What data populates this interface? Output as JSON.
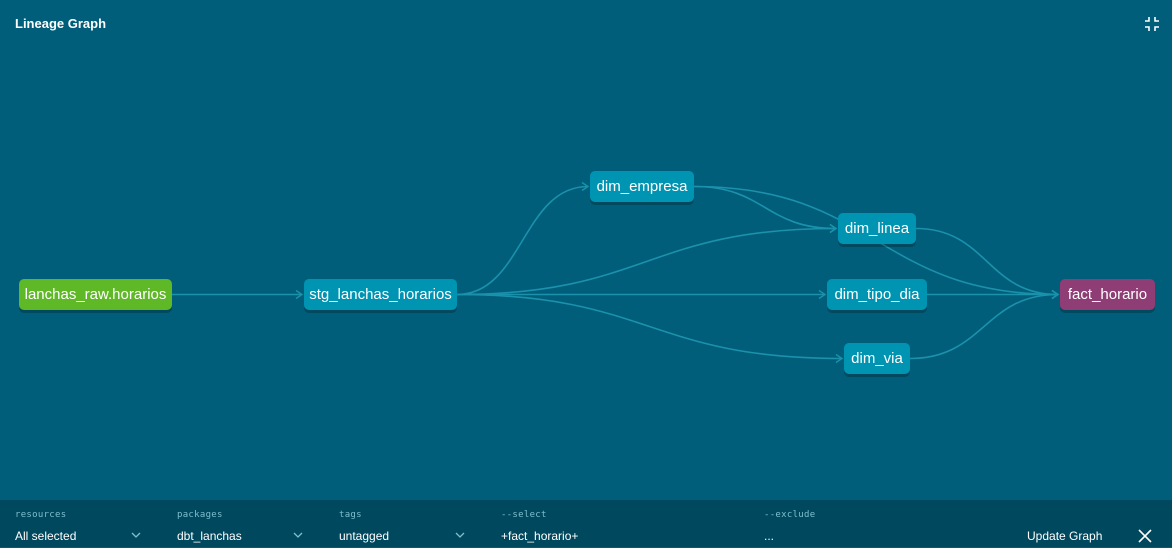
{
  "header": {
    "title": "Lineage Graph"
  },
  "graph": {
    "nodes": [
      {
        "id": "lanchas_raw",
        "label": "lanchas_raw.horarios",
        "type": "source"
      },
      {
        "id": "stg",
        "label": "stg_lanchas_horarios",
        "type": "model"
      },
      {
        "id": "dim_empresa",
        "label": "dim_empresa",
        "type": "model"
      },
      {
        "id": "dim_linea",
        "label": "dim_linea",
        "type": "model"
      },
      {
        "id": "dim_tipo_dia",
        "label": "dim_tipo_dia",
        "type": "model"
      },
      {
        "id": "dim_via",
        "label": "dim_via",
        "type": "model"
      },
      {
        "id": "fact_horario",
        "label": "fact_horario",
        "type": "selected"
      }
    ],
    "edges": [
      [
        "lanchas_raw",
        "stg"
      ],
      [
        "stg",
        "dim_empresa"
      ],
      [
        "stg",
        "dim_linea"
      ],
      [
        "stg",
        "dim_tipo_dia"
      ],
      [
        "stg",
        "dim_via"
      ],
      [
        "dim_empresa",
        "dim_linea"
      ],
      [
        "dim_empresa",
        "fact_horario"
      ],
      [
        "dim_linea",
        "fact_horario"
      ],
      [
        "dim_tipo_dia",
        "fact_horario"
      ],
      [
        "dim_via",
        "fact_horario"
      ]
    ]
  },
  "toolbar": {
    "resources": {
      "label": "resources",
      "value": "All selected"
    },
    "packages": {
      "label": "packages",
      "value": "dbt_lanchas"
    },
    "tags": {
      "label": "tags",
      "value": "untagged"
    },
    "select": {
      "label": "--select",
      "value": "+fact_horario+"
    },
    "exclude": {
      "label": "--exclude",
      "value": "..."
    },
    "update_label": "Update Graph"
  },
  "colors": {
    "background": "#005e7a",
    "toolbar": "#00485e",
    "model_node": "#0094b3",
    "source_node": "#5fb825",
    "selected_node": "#8e3e75",
    "edge": "#1b91ab"
  }
}
